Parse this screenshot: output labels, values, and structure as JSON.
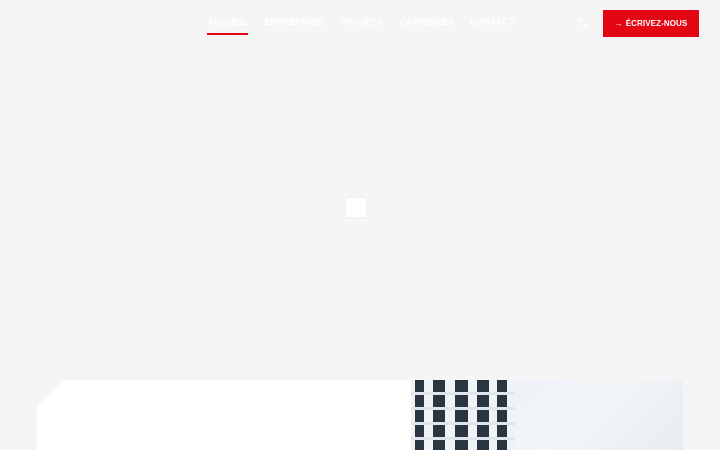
{
  "nav": {
    "items": [
      {
        "label": "Accueil",
        "active": true
      },
      {
        "label": "Entreprise",
        "active": false
      },
      {
        "label": "Projets",
        "active": false
      },
      {
        "label": "Carrières",
        "active": false
      },
      {
        "label": "Contact",
        "active": false
      }
    ],
    "phone_icon": "phone-icon",
    "cta_label": "ÉCRIVEZ-NOUS",
    "cta_arrow": "→"
  },
  "colors": {
    "accent": "#e30613",
    "background": "#f5f5f5",
    "nav_text": "#ffffff"
  }
}
